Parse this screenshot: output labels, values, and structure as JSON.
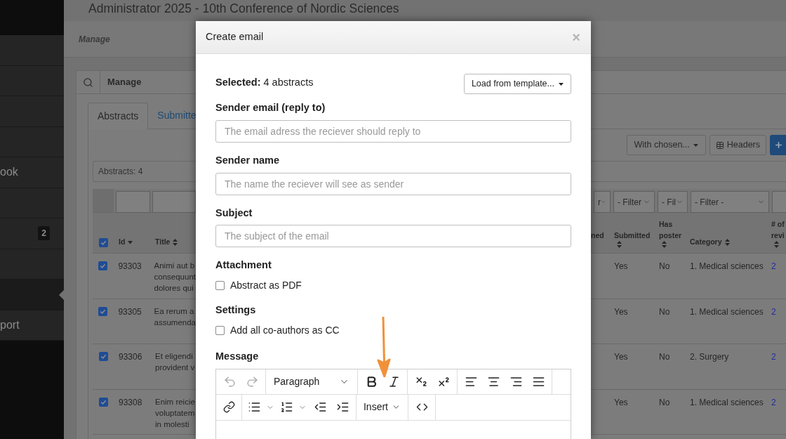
{
  "sidebar": {
    "items": [
      {
        "selected": false
      },
      {
        "selected": false
      },
      {
        "selected": false
      },
      {
        "selected": false
      },
      {
        "label": "ook",
        "selected": false
      },
      {
        "selected": false
      },
      {
        "badge": "2",
        "selected": false
      },
      {
        "selected": false
      },
      {
        "selected": true
      },
      {
        "label": "port",
        "selected": false
      }
    ]
  },
  "page_title": "Administrator 2025 - 10th Conference of Nordic Sciences",
  "breadcrumb": "Manage",
  "panel": {
    "title": "Manage",
    "tabs": [
      {
        "label": "Abstracts",
        "selected": true
      },
      {
        "label": "Submitte",
        "selected": false
      }
    ]
  },
  "toolbar": {
    "bulk_action": "With chosen...",
    "headers_button": "Headers"
  },
  "count": "Abstracts: 4",
  "table": {
    "select_all": true,
    "filters": [
      {
        "kind": "input"
      },
      {
        "kind": "input"
      },
      {
        "kind": "select",
        "label": "r"
      },
      {
        "kind": "select",
        "label": "- Filter"
      },
      {
        "kind": "select",
        "label": "- Fil"
      },
      {
        "kind": "select",
        "label": "- Filter -"
      },
      {
        "kind": "input"
      }
    ],
    "columns": [
      {
        "label": "Id",
        "sortable": true,
        "sorted": true
      },
      {
        "label": "Title",
        "sortable": true,
        "sorted": false
      },
      {
        "label": "ned"
      },
      {
        "label": "Submitted",
        "sortable": true,
        "sorted": false
      },
      {
        "label": "Has poster",
        "sortable": true,
        "sorted": false
      },
      {
        "label": "Category",
        "sortable": true,
        "sorted": false
      },
      {
        "label": "# of revi",
        "sortable": true,
        "sorted": false
      }
    ],
    "rows": [
      {
        "checked": true,
        "id": "93303",
        "title": [
          "Animi aut b",
          "consequunt",
          "dolores qui"
        ],
        "submitted": "Yes",
        "has_poster": "No",
        "category": "1. Medical sciences",
        "reviews": "2"
      },
      {
        "checked": true,
        "id": "93305",
        "title": [
          "Ea rerum a",
          "assumenda"
        ],
        "submitted": "Yes",
        "has_poster": "No",
        "category": "1. Medical sciences",
        "reviews": "2"
      },
      {
        "checked": true,
        "id": "93306",
        "title": [
          "Et eligendi",
          "provident v"
        ],
        "submitted": "Yes",
        "has_poster": "No",
        "category": "2. Surgery",
        "reviews": "2"
      },
      {
        "checked": true,
        "id": "93308",
        "title": [
          "Enim reicie",
          "voluptatem",
          "in molesti"
        ],
        "submitted": "Yes",
        "has_poster": "No",
        "category": "1. Medical sciences",
        "reviews": "2"
      }
    ]
  },
  "modal": {
    "title": "Create email",
    "close": "×",
    "selected": "**Selected:** 4 abstracts",
    "template_button": "Load from template...",
    "fields": [
      {
        "label": "Sender email (reply to)",
        "placeholder": "The email adress the reciever should reply to"
      },
      {
        "label": "Sender name",
        "placeholder": "The name the reciever will see as sender"
      },
      {
        "label": "Subject",
        "placeholder": "The subject of the email"
      }
    ],
    "options": [
      {
        "label": "Attachment",
        "checkbox": "Abstract as PDF",
        "checked": false
      },
      {
        "label": "Settings",
        "checkbox": "Add all co-authors as CC",
        "checked": false
      }
    ],
    "message": {
      "label": "Message",
      "block_format": "Paragraph",
      "insert_menu": "Insert"
    }
  }
}
